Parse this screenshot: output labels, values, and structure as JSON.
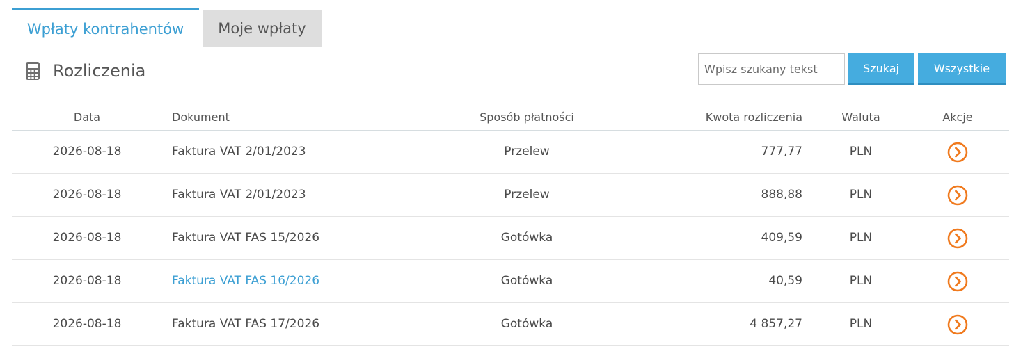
{
  "tabs": [
    {
      "label": "Wpłaty kontrahentów",
      "active": true
    },
    {
      "label": "Moje wpłaty",
      "active": false
    }
  ],
  "section": {
    "title": "Rozliczenia",
    "icon": "calculator-icon"
  },
  "search": {
    "placeholder": "Wpisz szukany tekst",
    "value": "",
    "search_label": "Szukaj",
    "all_label": "Wszystkie"
  },
  "table": {
    "headers": {
      "date": "Data",
      "document": "Dokument",
      "method": "Sposób płatności",
      "amount": "Kwota rozliczenia",
      "currency": "Waluta",
      "actions": "Akcje"
    },
    "rows": [
      {
        "date": "2026-08-18",
        "document": "Faktura VAT 2/01/2023",
        "method": "Przelew",
        "amount": "777,77",
        "currency": "PLN",
        "highlight": false
      },
      {
        "date": "2026-08-18",
        "document": "Faktura VAT 2/01/2023",
        "method": "Przelew",
        "amount": "888,88",
        "currency": "PLN",
        "highlight": false
      },
      {
        "date": "2026-08-18",
        "document": "Faktura VAT FAS 15/2026",
        "method": "Gotówka",
        "amount": "409,59",
        "currency": "PLN",
        "highlight": false
      },
      {
        "date": "2026-08-18",
        "document": "Faktura VAT FAS 16/2026",
        "method": "Gotówka",
        "amount": "40,59",
        "currency": "PLN",
        "highlight": true
      },
      {
        "date": "2026-08-18",
        "document": "Faktura VAT FAS 17/2026",
        "method": "Gotówka",
        "amount": "4 857,27",
        "currency": "PLN",
        "highlight": false
      }
    ]
  },
  "colors": {
    "accent": "#45acdf",
    "link": "#3c9fd3",
    "action": "#f07a1e",
    "tab_inactive_bg": "#dedede"
  }
}
